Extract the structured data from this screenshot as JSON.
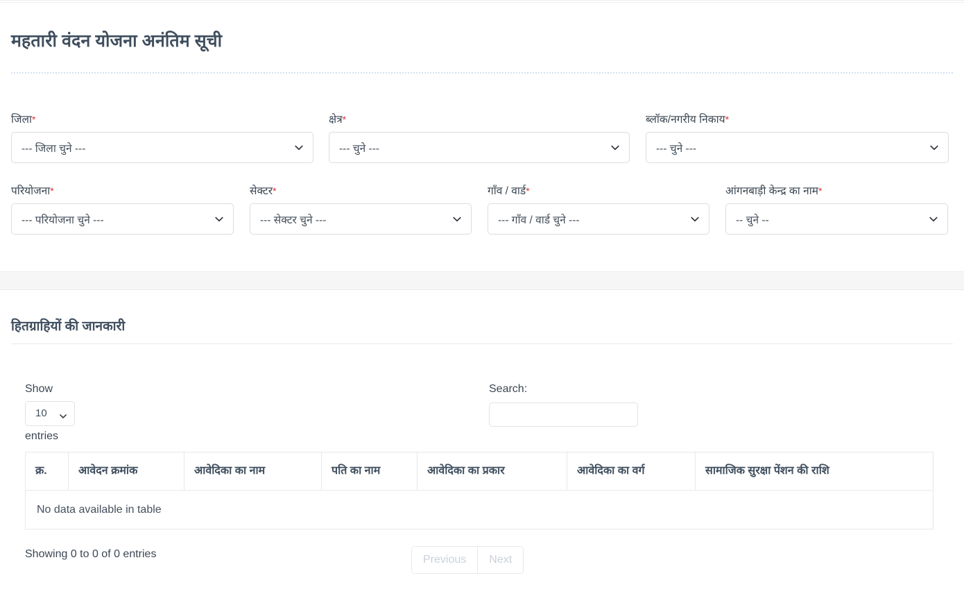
{
  "header": {
    "title": "महतारी वंदन योजना अनंतिम सूची"
  },
  "filters": {
    "required_marker": "*",
    "fields": [
      {
        "label": "जिला",
        "required": true,
        "value": "--- जिला चुने ---",
        "icon": "chevron-down-icon"
      },
      {
        "label": "क्षेत्र",
        "required": true,
        "value": "--- चुने ---",
        "icon": "chevron-down-icon"
      },
      {
        "label": "ब्लॉक/नगरीय निकाय",
        "required": true,
        "value": "--- चुने ---",
        "icon": "chevron-down-icon"
      },
      {
        "label": "परियोजना",
        "required": true,
        "value": "--- परियोजना चुने ---",
        "icon": "chevron-down-icon"
      },
      {
        "label": "सेक्टर",
        "required": true,
        "value": "--- सेक्टर चुने ---",
        "icon": "chevron-down-icon"
      },
      {
        "label": "गाँव / वार्ड",
        "required": true,
        "value": "--- गाँव / वार्ड चुने ---",
        "icon": "chevron-down-icon"
      },
      {
        "label": "आंगनबाड़ी केन्द्र का नाम",
        "required": true,
        "value": "-- चुने --",
        "icon": "chevron-down-icon"
      }
    ]
  },
  "results": {
    "section_title": "हितग्राहियों की जानकारी",
    "length_label_prefix": "Show",
    "length_label_suffix": "entries",
    "length_value": "10",
    "length_icon": "chevron-down-icon",
    "search_label": "Search:",
    "search_value": "",
    "search_placeholder": "",
    "columns": [
      "क्र.",
      "आवेदन क्रमांक",
      "आवेदिका का नाम",
      "पति का नाम",
      "आवेदिका का प्रकार",
      "आवेदिका का वर्ग",
      "सामाजिक सुरक्षा पेंशन की राशि"
    ],
    "rows": [],
    "empty_message": "No data available in table",
    "info_text": "Showing 0 to 0 of 0 entries",
    "pagination": {
      "previous_label": "Previous",
      "next_label": "Next"
    }
  },
  "colors": {
    "heading": "#3f4e5e",
    "text": "#3b4753",
    "required_asterisk": "#e03030",
    "border": "#d8dde3",
    "band": "#f6f6f7",
    "dotted_divider": "#d4e2f0",
    "disabled_pagination": "#c9d1da"
  }
}
